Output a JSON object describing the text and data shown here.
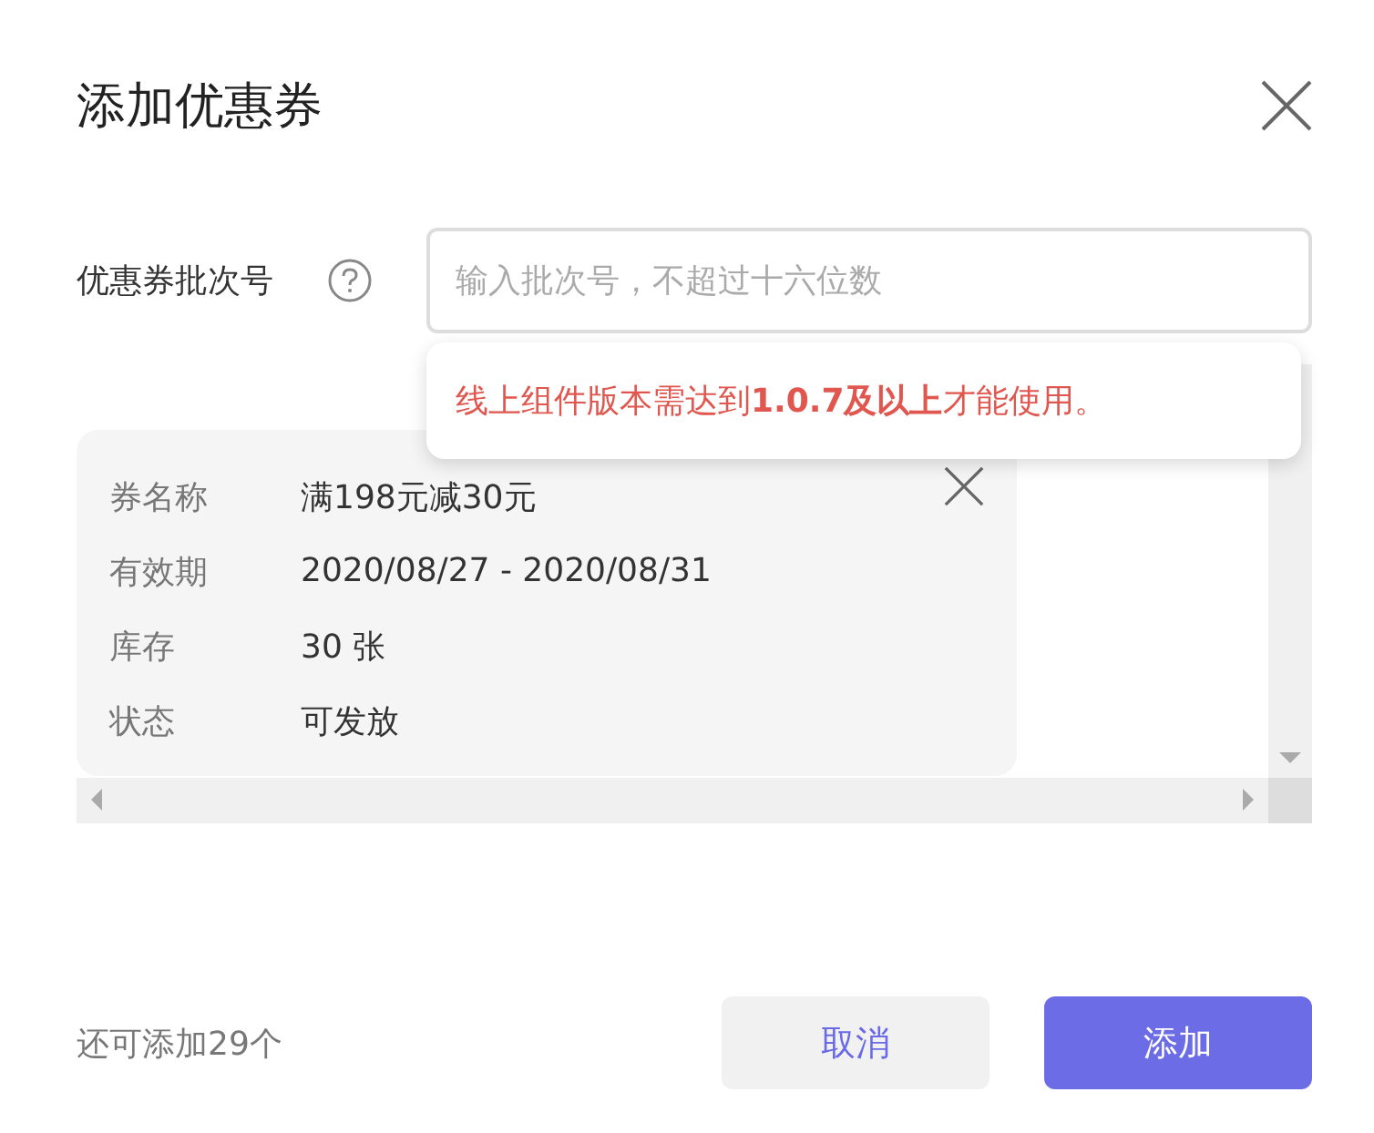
{
  "dialog": {
    "title": "添加优惠券"
  },
  "batch_field": {
    "label": "优惠券批次号",
    "placeholder": "输入批次号，不超过十六位数"
  },
  "tooltip": {
    "text": "线上组件版本需达到**1.0.7及以上**才能使用。"
  },
  "coupon_card": {
    "fields": [
      {
        "label": "券名称",
        "value": "满198元减30元"
      },
      {
        "label": "有效期",
        "value": "2020/08/27 - 2020/08/31"
      },
      {
        "label": "库存",
        "value": "30 张"
      },
      {
        "label": "状态",
        "value": "可发放"
      }
    ]
  },
  "footer": {
    "remaining": "还可添加29个",
    "buttons": [
      {
        "label": "取消",
        "kind": "secondary"
      },
      {
        "label": "添加",
        "kind": "primary"
      }
    ]
  }
}
